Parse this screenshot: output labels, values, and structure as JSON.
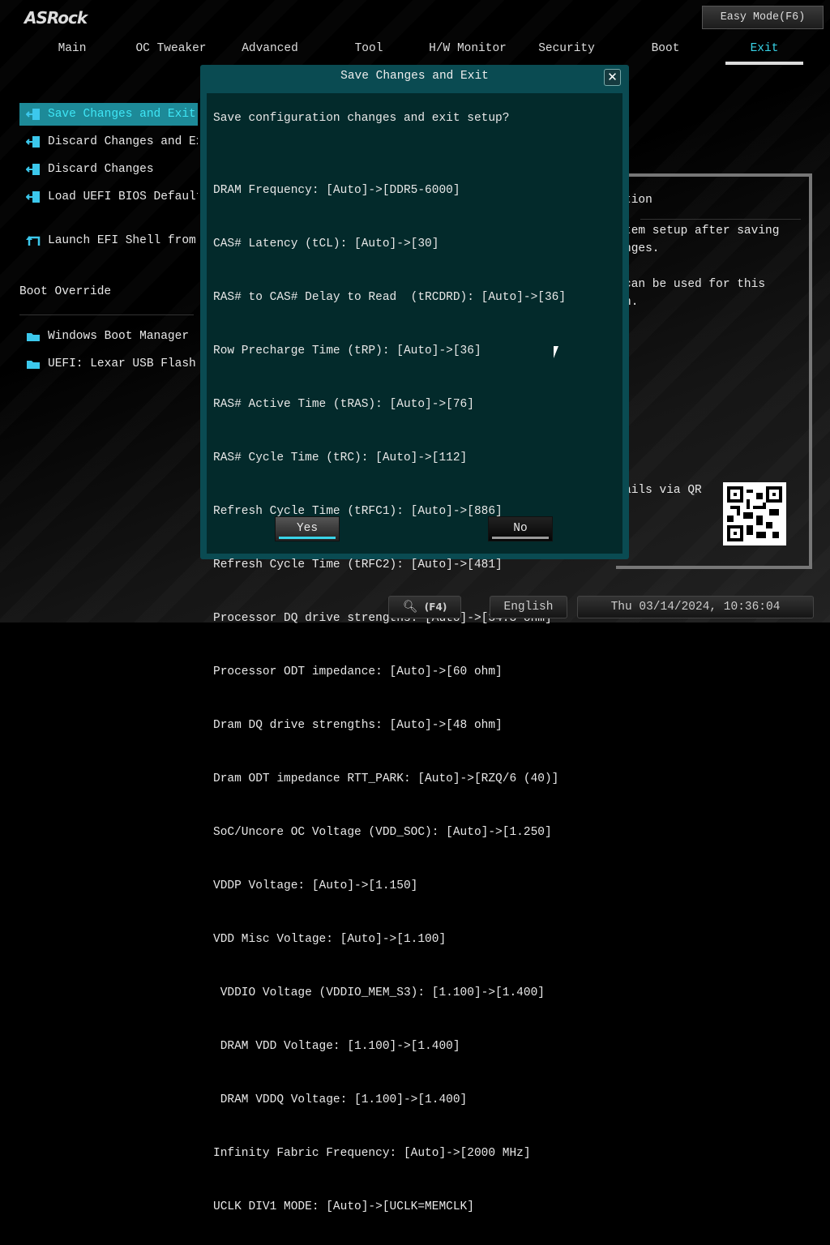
{
  "brand": "ASRock",
  "easy_mode": "Easy Mode(F6)",
  "tabs": [
    {
      "label": "Main"
    },
    {
      "label": "OC Tweaker"
    },
    {
      "label": "Advanced"
    },
    {
      "label": "Tool"
    },
    {
      "label": "H/W Monitor"
    },
    {
      "label": "Security"
    },
    {
      "label": "Boot"
    },
    {
      "label": "Exit",
      "active": true
    }
  ],
  "menu": [
    {
      "label": "Save Changes and Exit",
      "icon": "exit-door-icon"
    },
    {
      "label": "Discard Changes and Exit",
      "icon": "exit-door-icon"
    },
    {
      "label": "Discard Changes",
      "icon": "exit-door-icon"
    },
    {
      "label": "Load UEFI BIOS Defaults",
      "icon": "exit-door-icon"
    },
    {
      "label": "Launch EFI Shell from filesystem device",
      "icon": "shell-arrow-icon"
    }
  ],
  "boot_override": {
    "title": "Boot Override",
    "items": [
      {
        "label": "Windows Boot Manager (S",
        "icon": "folder-icon"
      },
      {
        "label": "UEFI: Lexar USB Flash D",
        "icon": "folder-icon"
      }
    ]
  },
  "description": {
    "title": "tion",
    "text1": "tem setup after saving",
    "text1b": "nges.",
    "text2": "can be used for this",
    "text2b": "n.",
    "qr_text": "ails via QR"
  },
  "dialog": {
    "title": "Save Changes and Exit",
    "question": "Save configuration changes and exit setup?",
    "changes": [
      "DRAM Frequency: [Auto]->[DDR5-6000]",
      "CAS# Latency (tCL): [Auto]->[30]",
      "RAS# to CAS# Delay to Read  (tRCDRD): [Auto]->[36]",
      "Row Precharge Time (tRP): [Auto]->[36]",
      "RAS# Active Time (tRAS): [Auto]->[76]",
      "RAS# Cycle Time (tRC): [Auto]->[112]",
      "Refresh Cycle Time (tRFC1): [Auto]->[886]",
      "Refresh Cycle Time (tRFC2): [Auto]->[481]",
      "Processor DQ drive strengths: [Auto]->[34.3 ohm]",
      "Processor ODT impedance: [Auto]->[60 ohm]",
      "Dram DQ drive strengths: [Auto]->[48 ohm]",
      "Dram ODT impedance RTT_PARK: [Auto]->[RZQ/6 (40)]",
      "SoC/Uncore OC Voltage (VDD_SOC): [Auto]->[1.250]",
      "VDDP Voltage: [Auto]->[1.150]",
      "VDD Misc Voltage: [Auto]->[1.100]",
      " VDDIO Voltage (VDDIO_MEM_S3): [1.100]->[1.400]",
      " DRAM VDD Voltage: [1.100]->[1.400]",
      " DRAM VDDQ Voltage: [1.100]->[1.400]",
      "Infinity Fabric Frequency: [Auto]->[2000 MHz]",
      "UCLK DIV1 MODE: [Auto]->[UCLK=MEMCLK]"
    ],
    "yes": "Yes",
    "no": "No"
  },
  "footer": {
    "search": "(F4)",
    "language": "English",
    "datetime": "Thu 03/14/2024, 10:36:04"
  },
  "colors": {
    "accent": "#38d4e8",
    "dialog": "#0a4b52"
  }
}
